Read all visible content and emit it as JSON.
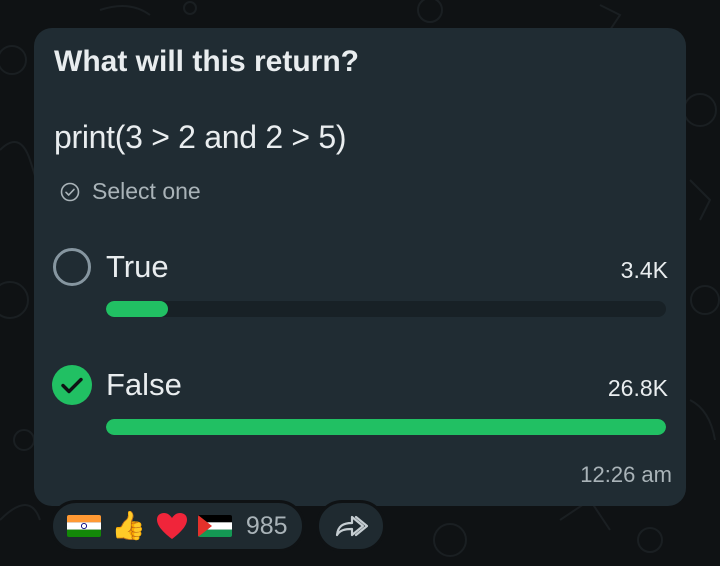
{
  "poll": {
    "question": "What will this return?",
    "code": "print(3 > 2 and 2 > 5)",
    "instruction": "Select one",
    "options": [
      {
        "label": "True",
        "votes": "3.4K",
        "fraction": 0.11,
        "selected": false
      },
      {
        "label": "False",
        "votes": "26.8K",
        "fraction": 1.0,
        "selected": true
      }
    ],
    "time": "12:26 am"
  },
  "reactions": {
    "emojis": [
      {
        "name": "flag-india",
        "glyph": "🇮🇳"
      },
      {
        "name": "thumbs-up",
        "glyph": "👍"
      },
      {
        "name": "red-heart",
        "glyph": "❤️"
      },
      {
        "name": "flag-palestine",
        "glyph": "🇵🇸"
      }
    ],
    "count": "985"
  },
  "colors": {
    "accent": "#21c063",
    "bubble": "#202c33",
    "background": "#0f1214",
    "muted": "#a9b3b8"
  }
}
